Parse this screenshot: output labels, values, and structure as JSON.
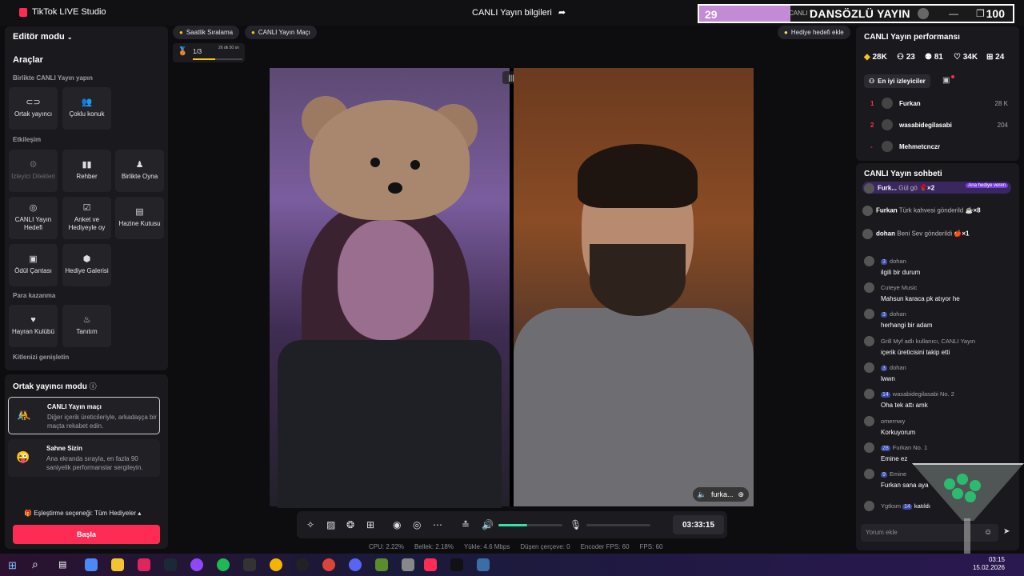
{
  "titlebar": {
    "app_title": "TikTok LIVE Studio",
    "center_title": "CANLI Yayın bilgileri",
    "overlay_left_num": "29",
    "overlay_ghost": "CANLI Y",
    "overlay_name": "DANSÖZLÜ YAYIN",
    "overlay_right_num": "100",
    "overlay_progress": 0.29,
    "min_icon": "—",
    "max_icon": "❐",
    "close_icon": "✕"
  },
  "left": {
    "editor_mode": "Editör modu",
    "tools_title": "Araçlar",
    "sec_together": "Birlikte CANLI Yayın yapın",
    "tile_cohost": "Ortak yayıncı",
    "tile_multi": "Çoklu konuk",
    "sec_interaction": "Etkileşim",
    "tile_requests": "İzleyici Dilekleri",
    "tile_guide": "Rehber",
    "tile_play": "Birlikte Oyna",
    "tile_goal": "CANLI Yayın Hedefi",
    "tile_poll": "Anket ve Hediyeyle oy",
    "tile_treasure": "Hazine Kutusu",
    "tile_prize": "Ödül Çantası",
    "tile_gallery": "Hediye Galerisi",
    "sec_monetize": "Para kazanma",
    "tile_fanclub": "Hayran Kulübü",
    "tile_promo": "Tanıtım",
    "sec_audience": "Kitlenizi genişletin"
  },
  "cohost": {
    "title": "Ortak yayıncı modu",
    "match_title": "CANLI Yayın maçı",
    "match_desc": "Diğer içerik üreticileriyle, arkadaşça bir maçta rekabet edin.",
    "stage_title": "Sahne Sizin",
    "stage_desc": "Ana ekranda sırayla, en fazla 90 saniyelik performanslar sergileyin.",
    "match_option": "Eşleştirme seçeneği: Tüm Hediyeler",
    "start": "Başla"
  },
  "topbar": {
    "hourly_rank": "Saatlik Sıralama",
    "live_match": "CANLI Yayın Maçı",
    "add_gift_goal": "Hediye hedefi ekle",
    "rank_count": "1/3",
    "rank_timer": "26 dk 50 sn",
    "rank_progress": 0.45
  },
  "video": {
    "right_tag": "furka...",
    "split_icon": "|||"
  },
  "controls": {
    "timer": "03:33:15",
    "volume_level": 0.45,
    "mic_level": 0.0
  },
  "stats": {
    "cpu": "CPU:  2.22%",
    "memory": "Bellek:  2.18%",
    "upload": "Yükle:  4.6 Mbps",
    "dropped": "Düşen çerçeve:  0",
    "encoder_fps": "Encoder FPS:  60",
    "fps": "FPS:  60"
  },
  "performance": {
    "title": "CANLI Yayın performansı",
    "diamonds": "28K",
    "viewers": "23",
    "followers": "81",
    "likes": "34K",
    "gifts": "24",
    "top_viewers_tab": "En iyi izleyiciler",
    "rows": [
      {
        "rank": "1",
        "name": "Furkan",
        "score": "28 K"
      },
      {
        "rank": "2",
        "name": "wasabidegilasabi",
        "score": "204"
      },
      {
        "rank": "-",
        "name": "Mehmetcnczr",
        "score": ""
      }
    ]
  },
  "chat": {
    "title": "CANLI Yayın sohbeti",
    "gift1_user": "Furk...",
    "gift1_text": "Gül gö",
    "gift1_count": "×2",
    "gift1_badge": "Ana hediye veren",
    "gift2_user": "Furkan",
    "gift2_text": "Türk kahvesi gönderild",
    "gift2_count": "×8",
    "gift3_user": "dohan",
    "gift3_text": "Beni Sev gönderildi",
    "gift3_count": "×1",
    "messages": [
      {
        "badge": "3",
        "user": "dohan",
        "text": "ilgili bir durum"
      },
      {
        "badge": "",
        "user": "Cuteye Music",
        "text": "Mahsun karaca pk atıyor he"
      },
      {
        "badge": "3",
        "user": "dohan",
        "text": "herhangi bir adam"
      },
      {
        "badge": "",
        "user": "Grill Myf  adlı kullanıcı, CANLI Yayın",
        "text": "içerik üreticisini takip etti"
      },
      {
        "badge": "3",
        "user": "dohan",
        "text": "lwwn"
      },
      {
        "badge": "14",
        "user": "wasabidegilasabi  No. 2",
        "text": "Oha tek attı amk"
      },
      {
        "badge": "",
        "user": "omernwy",
        "text": "Korkuyorum"
      },
      {
        "badge": "28",
        "user": "Furkan  No. 1",
        "text": "Emine ez"
      },
      {
        "badge": "9",
        "user": "Emine",
        "text": "Furkan sana aya"
      }
    ],
    "joined_user": "Ygtksm",
    "joined_badge": "14",
    "joined_text": "katıldı",
    "input_placeholder": "Yorum ekle"
  },
  "taskbar": {
    "time": "03:15",
    "date": "15.02.2026"
  }
}
